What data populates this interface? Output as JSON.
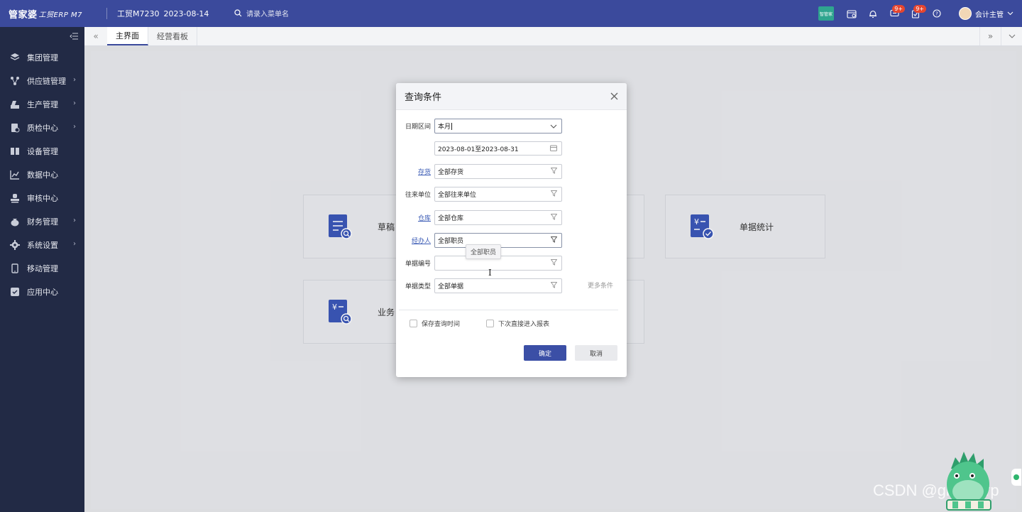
{
  "topbar": {
    "logo": "管家婆",
    "logo_sub": "工贸ERP M7",
    "account": "工贸M7230",
    "date": "2023-08-14",
    "search_placeholder": "请录入菜单名",
    "app_icon_label": "智管家",
    "badge_messages": "9+",
    "badge_tasks": "9+",
    "user_name": "会计主管",
    "colors": {
      "bar": "#3b4a9c",
      "badge": "#e6462f"
    }
  },
  "sidebar": {
    "items": [
      {
        "label": "集团管理",
        "icon": "layers-icon",
        "has_arrow": false
      },
      {
        "label": "供应链管理",
        "icon": "supply-chain-icon",
        "has_arrow": true
      },
      {
        "label": "生产管理",
        "icon": "production-icon",
        "has_arrow": true
      },
      {
        "label": "质检中心",
        "icon": "inspection-icon",
        "has_arrow": true
      },
      {
        "label": "设备管理",
        "icon": "equipment-icon",
        "has_arrow": false
      },
      {
        "label": "数据中心",
        "icon": "chart-icon",
        "has_arrow": false
      },
      {
        "label": "审核中心",
        "icon": "stamp-icon",
        "has_arrow": false
      },
      {
        "label": "财务管理",
        "icon": "money-bag-icon",
        "has_arrow": true
      },
      {
        "label": "系统设置",
        "icon": "gear-icon",
        "has_arrow": true
      },
      {
        "label": "移动管理",
        "icon": "mobile-icon",
        "has_arrow": false
      },
      {
        "label": "应用中心",
        "icon": "app-icon",
        "has_arrow": false
      }
    ]
  },
  "tabs": [
    {
      "label": "主界面",
      "active": true
    },
    {
      "label": "经营看板",
      "active": false
    }
  ],
  "cards": [
    {
      "label": "草稿",
      "icon": "draft-search-icon"
    },
    {
      "label": "单据统计",
      "icon": "yen-check-icon"
    },
    {
      "label": "业务",
      "icon": "yen-search-icon"
    }
  ],
  "dialog": {
    "title": "查询条件",
    "fields": {
      "date_range_label": "日期区间",
      "date_range_value": "本月",
      "date_period_value": "2023-08-01至2023-08-31",
      "inventory_label": "存货",
      "inventory_value": "全部存货",
      "partner_label": "往来单位",
      "partner_value": "全部往来单位",
      "warehouse_label": "仓库",
      "warehouse_value": "全部仓库",
      "handler_label": "经办人",
      "handler_value": "全部职员",
      "doc_no_label": "单据编号",
      "doc_no_value": "",
      "doc_type_label": "单据类型",
      "doc_type_value": "全部单据"
    },
    "more_conditions": "更多条件",
    "save_time_label": "保存查询时间",
    "direct_report_label": "下次直接进入报表",
    "ok_label": "确定",
    "cancel_label": "取消",
    "tooltip": "全部职员"
  },
  "watermark": "CSDN @grasperp"
}
